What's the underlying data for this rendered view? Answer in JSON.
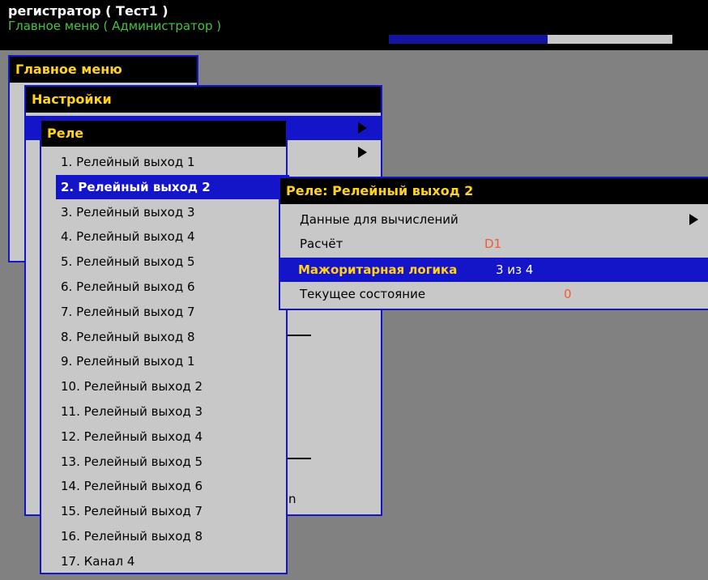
{
  "header": {
    "title": "регистратор ( Тест1 )",
    "subtitle": "Главное меню ( Администратор )",
    "progress_fraction": 0.56
  },
  "main_menu": {
    "title": "Главное меню"
  },
  "settings_menu": {
    "title": "Настройки"
  },
  "relay_menu": {
    "title": "Реле",
    "items": [
      "1. Релейный выход 1",
      "2. Релейный выход 2",
      "3. Релейный выход 3",
      "4. Релейный выход 4",
      "5. Релейный выход 5",
      "6. Релейный выход 6",
      "7. Релейный выход 7",
      "8. Релейный выход 8",
      "9. Релейный выход 1",
      "10. Релейный выход 2",
      "11. Релейный выход 3",
      "12. Релейный выход 4",
      "13. Релейный выход 5",
      "14. Релейный выход 6",
      "15. Релейный выход 7",
      "16. Релейный выход 8",
      "17. Канал 4"
    ],
    "selected_index": 1
  },
  "relay_detail": {
    "title": "Реле: Релейный выход 2",
    "rows": [
      {
        "label": "Данные для вычислений",
        "value": ""
      },
      {
        "label": "Расчёт",
        "value": "D1"
      },
      {
        "label": "Мажоритарная логика",
        "value": "3 из 4"
      },
      {
        "label": "Текущее состояние",
        "value": "0"
      }
    ]
  },
  "partial_text": {
    "glyph": "n"
  },
  "colors": {
    "accent": "#1414c8",
    "title_text": "#ffd21e",
    "value_text": "#f05a3c",
    "panel_bg": "#c8c8c8",
    "desktop_bg": "#818181"
  }
}
